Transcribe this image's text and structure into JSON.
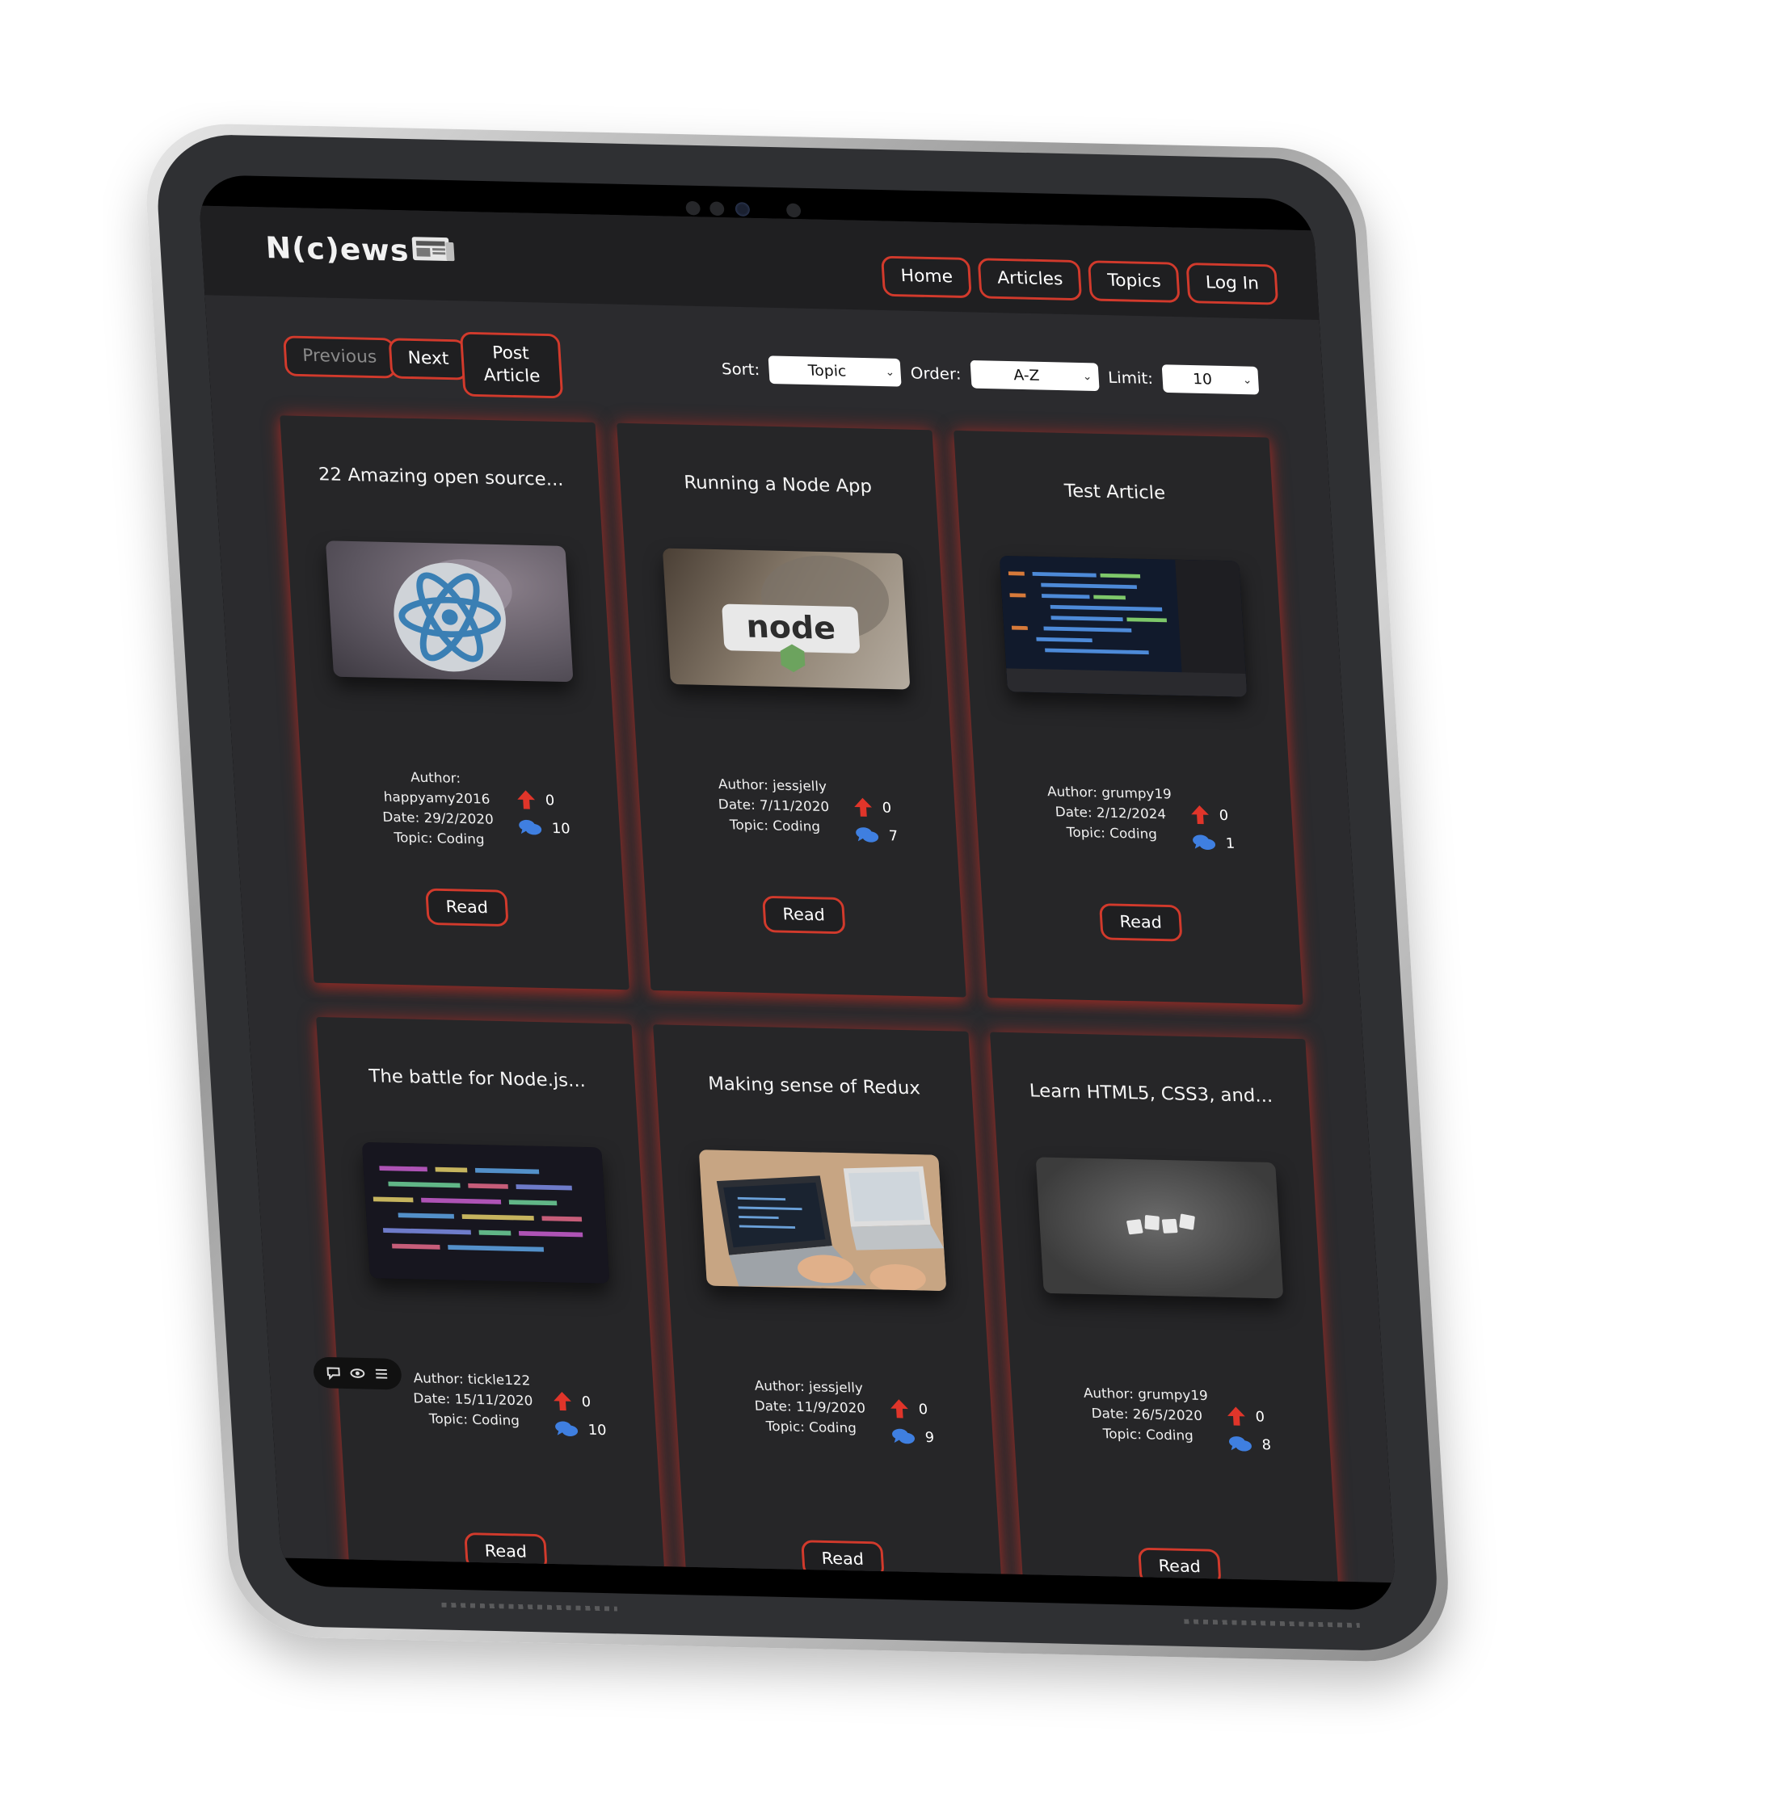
{
  "header": {
    "logo": "N(c)ews",
    "nav": [
      "Home",
      "Articles",
      "Topics",
      "Log In"
    ]
  },
  "controls": {
    "previous": "Previous",
    "next": "Next",
    "post_line1": "Post",
    "post_line2": "Article",
    "sort_label": "Sort:",
    "sort_value": "Topic",
    "order_label": "Order:",
    "order_value": "A-Z",
    "limit_label": "Limit:",
    "limit_value": "10"
  },
  "articles": [
    {
      "title": "22 Amazing open source...",
      "author_line": "Author:",
      "author_line2": "happyamy2016",
      "date": "Date: 29/2/2020",
      "topic": "Topic: Coding",
      "votes": "0",
      "comments": "10",
      "read": "Read",
      "image": "react-sticker"
    },
    {
      "title": "Running a Node App",
      "author_line": "Author: jessjelly",
      "author_line2": "",
      "date": "Date: 7/11/2020",
      "topic": "Topic: Coding",
      "votes": "0",
      "comments": "7",
      "read": "Read",
      "image": "nodejs-sticker"
    },
    {
      "title": "Test Article",
      "author_line": "Author: grumpy19",
      "author_line2": "",
      "date": "Date: 2/12/2024",
      "topic": "Topic: Coding",
      "votes": "0",
      "comments": "1",
      "read": "Read",
      "image": "code-screen"
    },
    {
      "title": "The battle for Node.js...",
      "author_line": "Author: tickle122",
      "author_line2": "",
      "date": "Date: 15/11/2020",
      "topic": "Topic: Coding",
      "votes": "0",
      "comments": "10",
      "read": "Read",
      "image": "colorful-code"
    },
    {
      "title": "Making sense of Redux",
      "author_line": "Author: jessjelly",
      "author_line2": "",
      "date": "Date: 11/9/2020",
      "topic": "Topic: Coding",
      "votes": "0",
      "comments": "9",
      "read": "Read",
      "image": "laptops-desk"
    },
    {
      "title": "Learn HTML5, CSS3, and...",
      "author_line": "Author: grumpy19",
      "author_line2": "",
      "date": "Date: 26/5/2020",
      "topic": "Topic: Coding",
      "votes": "0",
      "comments": "8",
      "read": "Read",
      "image": "html-tiles"
    }
  ],
  "icons": {
    "upvote": "arrow-up-icon",
    "comments": "comments-icon",
    "logo": "newspaper-icon"
  },
  "colors": {
    "accent": "#d23a2c",
    "background": "#2b2b2e",
    "topbar": "#1f1f21",
    "upvote": "#e0352a",
    "comments": "#3f7fe0"
  }
}
